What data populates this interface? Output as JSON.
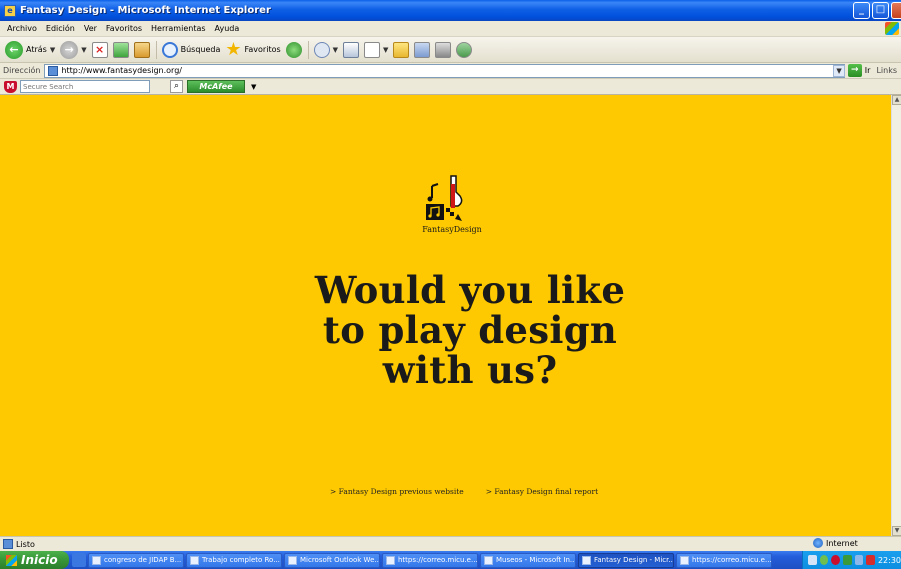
{
  "window": {
    "title": "Fantasy Design - Microsoft Internet Explorer",
    "controls": [
      "_",
      "□",
      "×"
    ]
  },
  "menu": [
    "Archivo",
    "Edición",
    "Ver",
    "Favoritos",
    "Herramientas",
    "Ayuda"
  ],
  "toolbar": {
    "back_label": "Atrás",
    "search_label": "Búsqueda",
    "favorites_label": "Favoritos"
  },
  "address": {
    "label": "Dirección",
    "url": "http://www.fantasydesign.org/",
    "go_label": "Ir",
    "links_label": "Links"
  },
  "search_bar": {
    "placeholder": "Secure Search",
    "brand": "McAfee"
  },
  "page": {
    "logo_text": "FantasyDesign",
    "headline_lines": [
      "Would you like",
      "to play design",
      "with us?"
    ],
    "links": [
      "> Fantasy Design previous website",
      "> Fantasy Design final report"
    ],
    "background": "#fec900"
  },
  "status": {
    "text": "Listo",
    "zone": "Internet"
  },
  "taskbar": {
    "start_label": "Inicio",
    "tasks": [
      "congreso de JIDAP B...",
      "Trabajo completo Ro...",
      "Microsoft Outlook We...",
      "https://correo.micu.e...",
      "Museos - Microsoft In...",
      "Fantasy Design - Micr...",
      "https://correo.micu.e..."
    ],
    "active_task_index": 5,
    "clock": "22:30"
  }
}
